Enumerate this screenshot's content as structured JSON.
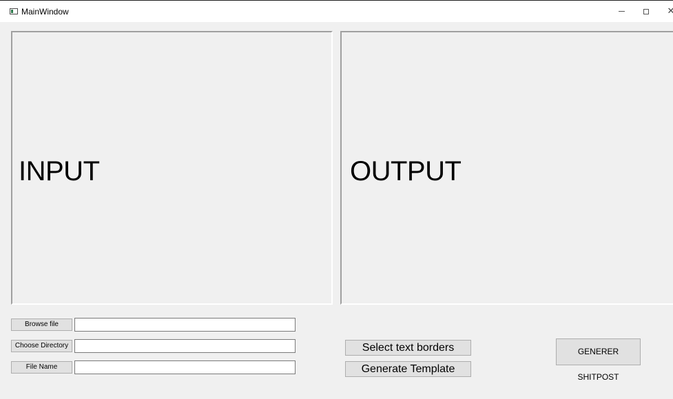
{
  "window": {
    "title": "MainWindow",
    "minimize_glyph": "",
    "maximize_glyph": "",
    "close_glyph": "✕",
    "icon": "app-window-icon"
  },
  "panels": {
    "input_label": "INPUT",
    "output_label": "OUTPUT"
  },
  "controls": {
    "browse_file_label": "Browse file",
    "browse_file_value": "",
    "choose_directory_label": "Choose Directory",
    "choose_directory_value": "",
    "file_name_label": "File Name",
    "file_name_value": "",
    "select_text_borders_label": "Select text borders",
    "generate_template_label": "Generate Template",
    "generer_shitpost_label": "GENERER SHITPOST"
  },
  "colors": {
    "window_bg": "#f0f0f0",
    "button_bg": "#e1e1e1",
    "button_border": "#adadad",
    "field_bg": "#ffffff"
  }
}
